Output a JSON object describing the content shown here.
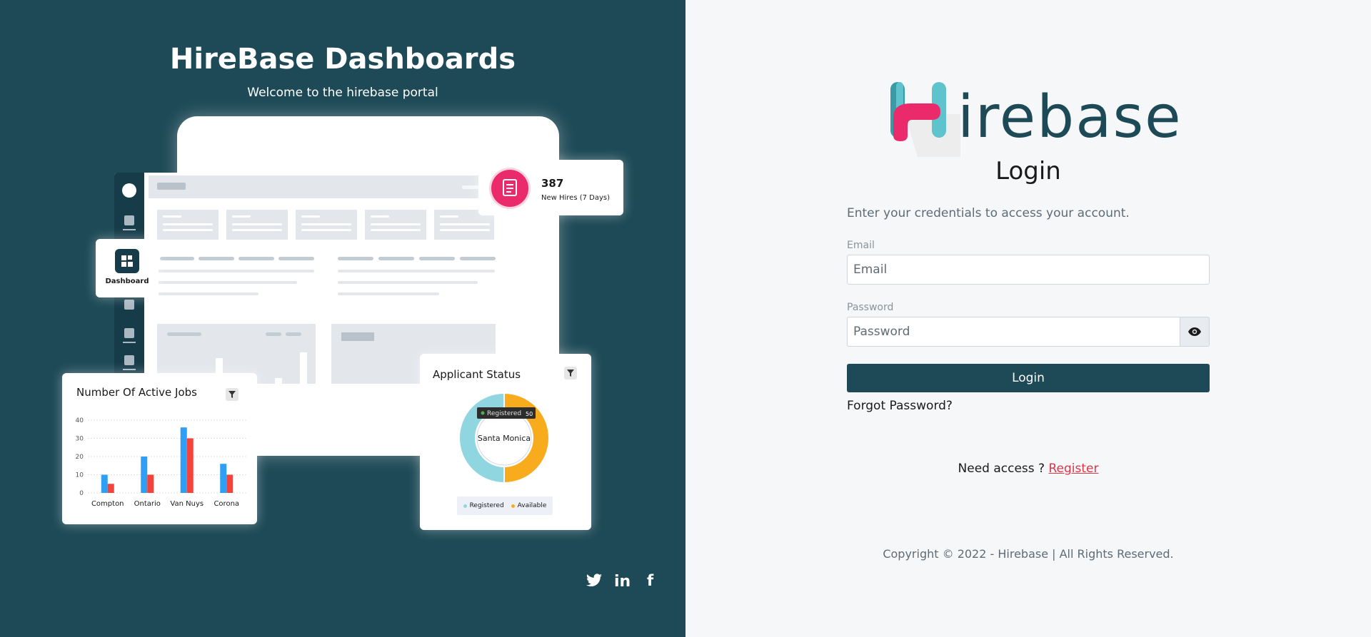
{
  "hero": {
    "title": "HireBase Dashboards",
    "subtitle": "Welcome to the hirebase portal"
  },
  "illustration": {
    "dashboard_label": "Dashboard",
    "new_hires": {
      "value": "387",
      "label": "New Hires (7 Days)"
    },
    "active_jobs": {
      "title": "Number Of Active Jobs"
    },
    "applicant_status": {
      "title": "Applicant Status",
      "center_label": "Santa Monica",
      "tooltip_label": "Registered",
      "tooltip_value": "50",
      "legend": [
        "Registered",
        "Available"
      ]
    }
  },
  "chart_data": [
    {
      "type": "bar",
      "title": "Number Of Active Jobs",
      "categories": [
        "Compton",
        "Ontario",
        "Van Nuys",
        "Corona"
      ],
      "series": [
        {
          "values": [
            10,
            20,
            36,
            16
          ],
          "color": "#2f9ff5"
        },
        {
          "values": [
            5,
            10,
            30,
            10
          ],
          "color": "#f4433b"
        }
      ],
      "ylim": [
        0,
        40
      ],
      "yticks": [
        0,
        10,
        20,
        30,
        40
      ],
      "grid": true
    },
    {
      "type": "pie",
      "title": "Applicant Status",
      "categories": [
        "Registered",
        "Available"
      ],
      "values": [
        50,
        50
      ],
      "colors": [
        "#8fd6e0",
        "#f8ab1d"
      ],
      "legend": "bottom"
    }
  ],
  "social": {
    "icons": [
      "twitter-icon",
      "linkedin-icon",
      "facebook-icon"
    ],
    "linkedin_text": "in",
    "facebook_text": "f"
  },
  "brand": {
    "logo_text": "irebase",
    "primary": "#1e4a57",
    "accent": "#ea2a6a",
    "teal": "#5ec3cd"
  },
  "login": {
    "title": "Login",
    "lead": "Enter your credentials to access your account.",
    "email_label": "Email",
    "email_placeholder": "Email",
    "password_label": "Password",
    "password_placeholder": "Password",
    "submit": "Login",
    "forgot": "Forgot Password?",
    "need_access": "Need access ?",
    "register": "Register",
    "copyright": "Copyright © 2022 - Hirebase | All Rights Reserved."
  }
}
